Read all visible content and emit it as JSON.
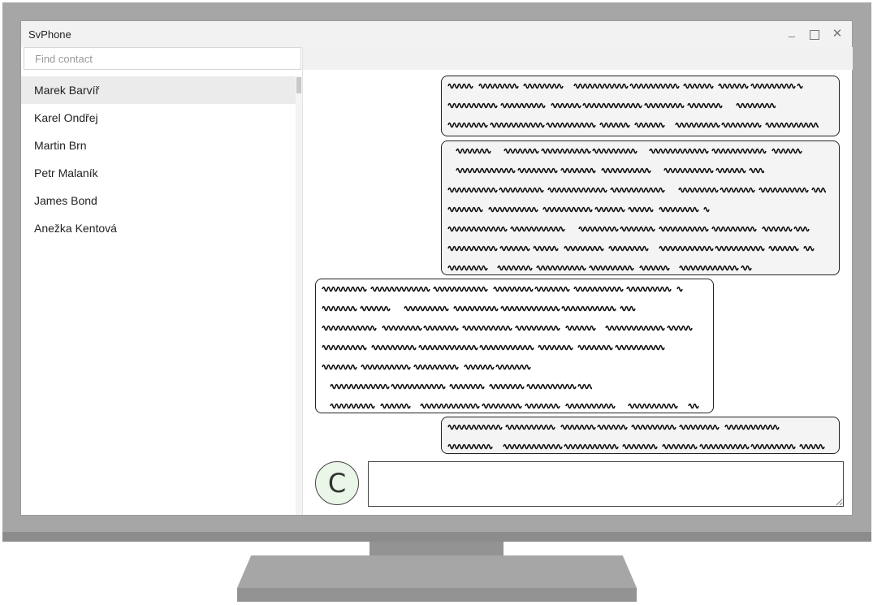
{
  "window": {
    "title": "SvPhone"
  },
  "titlebar_buttons": {
    "minimize": "_",
    "maximize": "□",
    "close": "✕"
  },
  "search": {
    "placeholder": "Find contact"
  },
  "contacts": [
    {
      "name": "Marek Barvíř",
      "selected": true
    },
    {
      "name": "Karel Ondřej"
    },
    {
      "name": "Martin Brn"
    },
    {
      "name": "Petr Malaník"
    },
    {
      "name": "James Bond"
    },
    {
      "name": "Anežka Kentová"
    }
  ],
  "messages": [
    {
      "direction": "outgoing",
      "line_count": 3
    },
    {
      "direction": "outgoing",
      "line_count": 7
    },
    {
      "direction": "incoming",
      "line_count": 7
    },
    {
      "direction": "outgoing",
      "line_count": 2
    }
  ],
  "compose": {
    "avatar_letter": "C",
    "value": ""
  },
  "colors": {
    "selected_row": "#ebebeb",
    "outgoing_bubble": "#f4f4f4",
    "avatar_bg": "#eaf6e8"
  }
}
